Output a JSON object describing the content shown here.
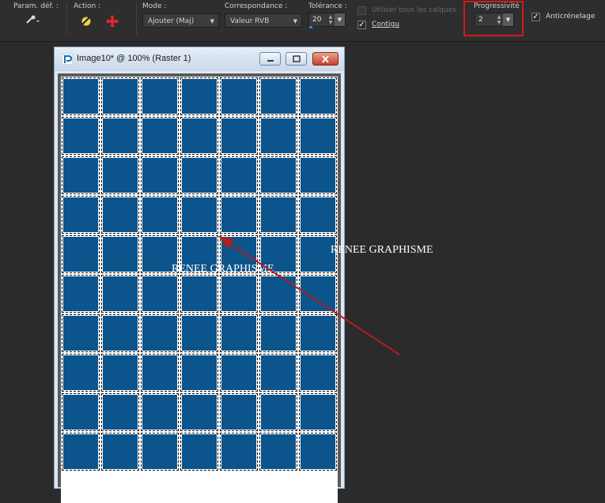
{
  "toolbar": {
    "presets": {
      "label": "Param. déf. :"
    },
    "action": {
      "label": "Action :"
    },
    "mode": {
      "label": "Mode :",
      "value": "Ajouter (Maj)"
    },
    "match": {
      "label": "Correspondance :",
      "value": "Valeur RVB"
    },
    "tolerance": {
      "label": "Tolérance :",
      "value": "20"
    },
    "use_all_layers": {
      "label": "Utiliser tous les calques",
      "checked": false,
      "enabled": false
    },
    "contiguous": {
      "label": "Contigu",
      "checked": true
    },
    "feather": {
      "label": "Progressivité :",
      "value": "2"
    },
    "antialias": {
      "label": "Anticrénelage",
      "checked": true
    }
  },
  "window": {
    "title": "Image10* @ 100% (Raster 1)",
    "grid": {
      "columns": 7,
      "rows": 10,
      "cell_color": "#0b548c"
    }
  },
  "watermarks": {
    "canvas": "RENEE GRAPHISME",
    "outside": "RENEE GRAPHISME"
  },
  "colors": {
    "highlight": "#d21b1b",
    "arrow": "#b01e1e"
  }
}
